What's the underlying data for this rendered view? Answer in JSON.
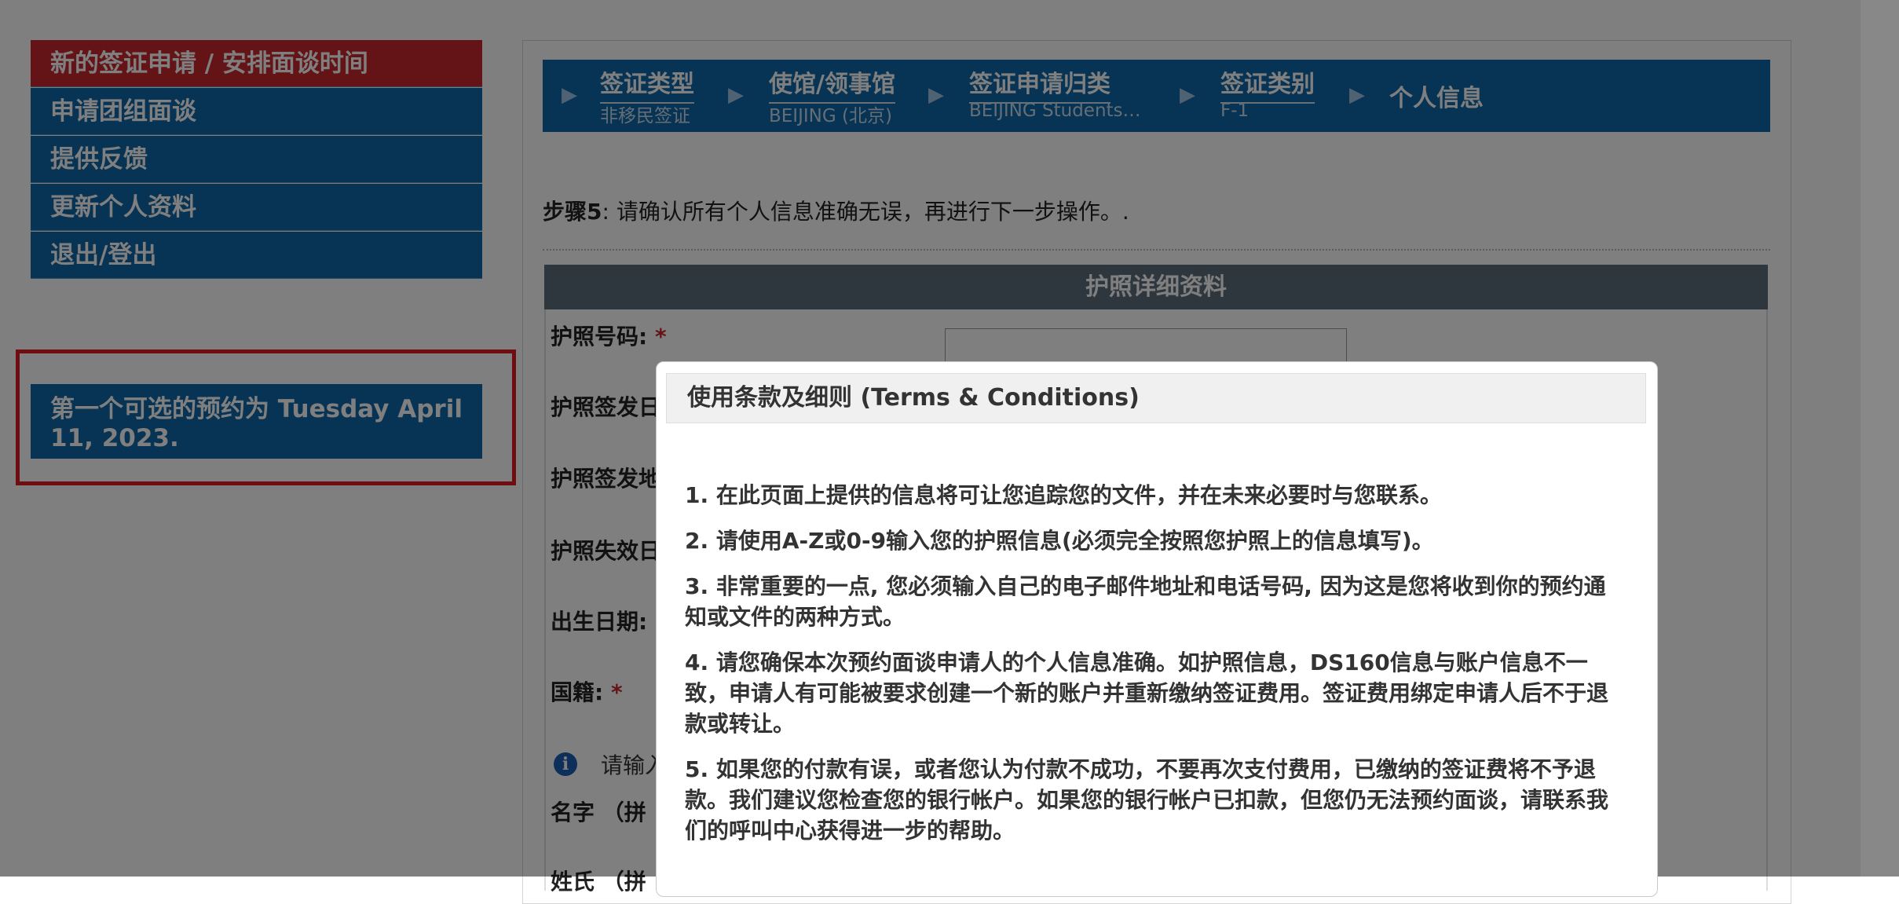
{
  "sidebar": {
    "items": [
      {
        "label": "新的签证申请 / 安排面谈时间",
        "active": true
      },
      {
        "label": "申请团组面谈"
      },
      {
        "label": "提供反馈"
      },
      {
        "label": "更新个人资料"
      },
      {
        "label": "退出/登出"
      }
    ],
    "availability": "第一个可选的预约为 Tuesday April 11, 2023."
  },
  "breadcrumb": {
    "steps": [
      {
        "label": "签证类型",
        "value": "非移民签证"
      },
      {
        "label": "使馆/领事馆",
        "value": "BEIJING (北京)"
      },
      {
        "label": "签证申请归类",
        "value": "BEIJING Students…"
      },
      {
        "label": "签证类别",
        "value": "F-1"
      },
      {
        "label": "个人信息"
      }
    ]
  },
  "step": {
    "prefix": "步骤5",
    "text": ": 请确认所有个人信息准确无误，再进行下一步操作。."
  },
  "section": {
    "title": "护照详细资料",
    "fields": [
      {
        "label": "护照号码:",
        "required": true
      },
      {
        "label": "护照签发日"
      },
      {
        "label": "护照签发地"
      },
      {
        "label": "护照失效日"
      },
      {
        "label": "出生日期:"
      },
      {
        "label": "国籍:",
        "required": true
      },
      {
        "label": "名字 （拼"
      },
      {
        "label": "姓氏 （拼"
      }
    ],
    "info_text": "请输入",
    "required_mark": "*"
  },
  "modal": {
    "title": "使用条款及细则 (Terms & Conditions)",
    "terms": [
      "1. 在此页面上提供的信息将可让您追踪您的文件，并在未来必要时与您联系。",
      "2. 请使用A-Z或0-9输入您的护照信息(必须完全按照您护照上的信息填写)。",
      "3. 非常重要的一点, 您必须输入自己的电子邮件地址和电话号码, 因为这是您将收到你的预约通知或文件的两种方式。",
      "4. 请您确保本次预约面谈申请人的个人信息准确。如护照信息，DS160信息与账户信息不一致，申请人有可能被要求创建一个新的账户并重新缴纳签证费用。签证费用绑定申请人后不于退款或转让。",
      "5. 如果您的付款有误，或者您认为付款不成功，不要再次支付费用，已缴纳的签证费将不予退款。我们建议您检查您的银行帐户。如果您的银行帐户已扣款，但您仍无法预约面谈，请联系我们的呼叫中心获得进一步的帮助。"
    ]
  },
  "colors": {
    "nav_blue": "#0e66a8",
    "active_red": "#c8262c",
    "section_gray": "#5e6e7c",
    "highlight_red": "#e01b22"
  },
  "icons": {
    "breadcrumb_separator": "chevron-right-icon",
    "info": "info-icon"
  }
}
